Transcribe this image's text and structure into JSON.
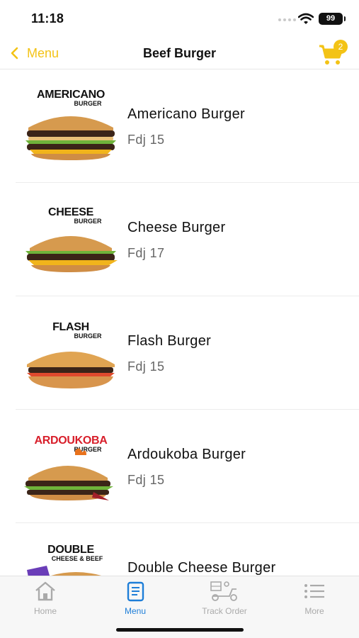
{
  "status_bar": {
    "time": "11:18",
    "battery": "99"
  },
  "nav": {
    "back_label": "Menu",
    "title": "Beef Burger",
    "cart_count": "2"
  },
  "items": [
    {
      "name": "Americano Burger",
      "price": "Fdj 15",
      "brand_line1": "AMERICANO",
      "brand_line2": "BURGER"
    },
    {
      "name": "Cheese Burger",
      "price": "Fdj 17",
      "brand_line1": "CHEESE",
      "brand_line2": "BURGER"
    },
    {
      "name": "Flash Burger",
      "price": "Fdj 15",
      "brand_line1": "FLASH",
      "brand_line2": "BURGER"
    },
    {
      "name": "Ardoukoba Burger",
      "price": "Fdj 15",
      "brand_line1": "ARDOUKOBA",
      "brand_line2": "BURGER"
    },
    {
      "name": "Double Cheese Burger",
      "price": "",
      "brand_line1": "DOUBLE",
      "brand_line2": "CHEESE & BEEF"
    }
  ],
  "tabs": [
    {
      "label": "Home",
      "icon": "home-icon"
    },
    {
      "label": "Menu",
      "icon": "menu-book-icon"
    },
    {
      "label": "Track Order",
      "icon": "delivery-scooter-icon"
    },
    {
      "label": "More",
      "icon": "list-icon"
    }
  ],
  "colors": {
    "accent": "#f3c316",
    "active_tab": "#1e7ed8",
    "inactive_tab": "#aaaaaa",
    "brand_red": "#d81e2a"
  }
}
